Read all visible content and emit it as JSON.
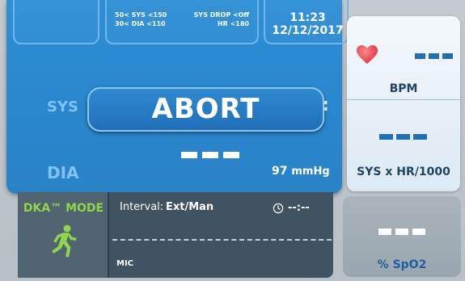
{
  "limits": {
    "sys": "50< SYS <150",
    "dia": "30< DIA <110",
    "sys_drop": "SYS DROP <Off",
    "hr": "HR <180"
  },
  "clock": {
    "time": "11:23",
    "date": "12/12/2017"
  },
  "main": {
    "sys_label": "SYS",
    "dia_label": "DIA",
    "abort_label": "ABORT",
    "map_value": "97",
    "map_unit": "mmHg",
    "peek_char": ":"
  },
  "right": {
    "bpm_label": "BPM",
    "sys_hr_label": "SYS x HR/1000",
    "heart_icon": "heart-icon"
  },
  "bottom": {
    "mode_label": "DKA™ MODE",
    "interval_label": "Interval:",
    "interval_value": "Ext/Man",
    "timer_value": "--:--",
    "mic_label": "MIC",
    "runner_icon": "running-person-icon"
  },
  "spo2": {
    "label": "% SpO2"
  },
  "colors": {
    "main_blue": "#2e8fd6",
    "accent_green": "#8fd44a",
    "dark_panel": "#3f5362",
    "heart_red": "#e8404a"
  }
}
